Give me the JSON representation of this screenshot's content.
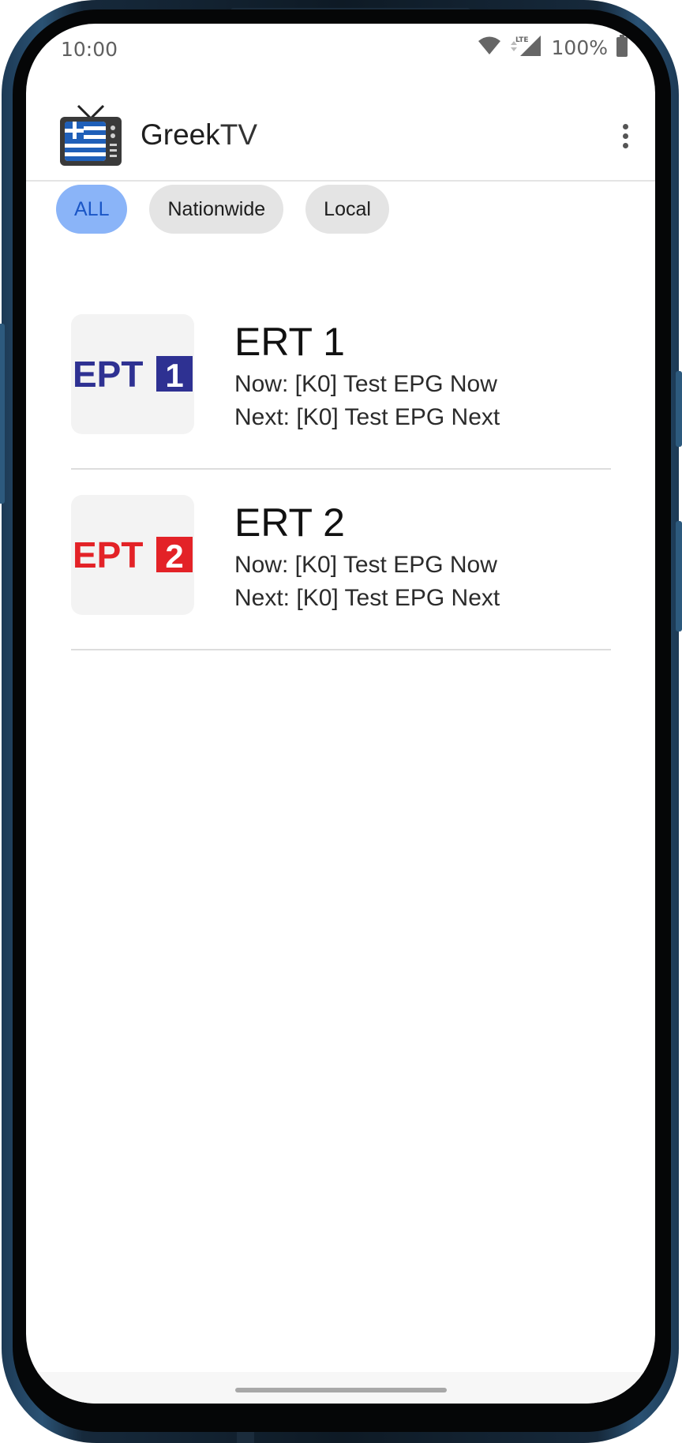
{
  "status_bar": {
    "time": "10:00",
    "battery_text": "100%",
    "icons": [
      "wifi-icon",
      "lte-signal-icon",
      "battery-icon"
    ]
  },
  "app_bar": {
    "title_bold": "Greek",
    "title_light": "TV",
    "logo": "greek-tv-logo-icon",
    "menu_icon": "overflow-menu-icon"
  },
  "filters": {
    "chips": [
      {
        "label": "ALL",
        "selected": true
      },
      {
        "label": "Nationwide",
        "selected": false
      },
      {
        "label": "Local",
        "selected": false
      }
    ],
    "active_color": "#8ab4f8",
    "inactive_color": "#e4e4e4"
  },
  "channels": [
    {
      "name": "ERT 1",
      "now": "Now: [K0] Test EPG Now",
      "next": "Next: [K0] Test EPG Next",
      "logo_text": "EPT",
      "logo_number": "1",
      "logo_color": "#2e3192"
    },
    {
      "name": "ERT 2",
      "now": "Now: [K0] Test EPG Now",
      "next": "Next: [K0] Test EPG Next",
      "logo_text": "EPT",
      "logo_number": "2",
      "logo_color": "#e32227"
    }
  ]
}
